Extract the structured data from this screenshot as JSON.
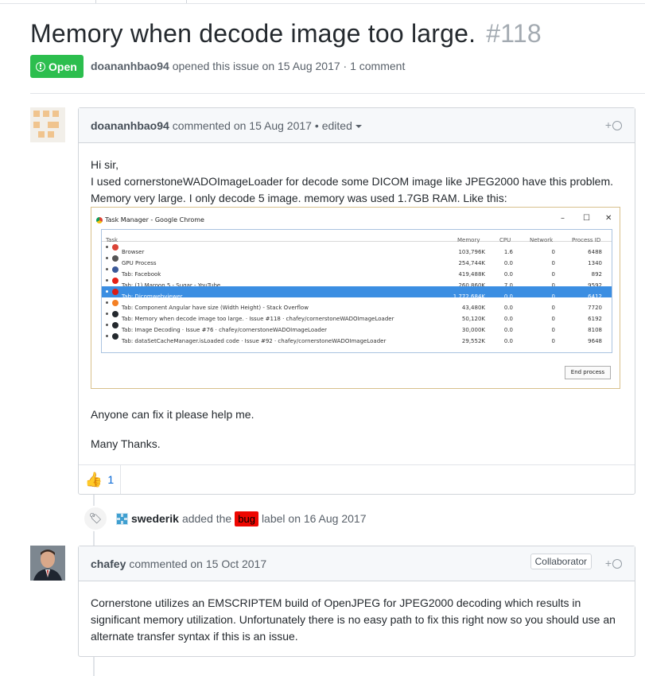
{
  "issue": {
    "title": "Memory when decode image too large.",
    "number": "#118",
    "state": "Open",
    "author": "doananhbao94",
    "meta_text": "opened this issue on 15 Aug 2017 · 1 comment"
  },
  "comment1": {
    "author": "doananhbao94",
    "meta": "commented on 15 Aug 2017 •",
    "edited": "edited",
    "react_plus": "+",
    "line1": "Hi sir,",
    "line2": "I used cornerstoneWADOImageLoader for decode some DICOM image like JPEG2000 have this problem.",
    "line3": "Memory very large. I only decode 5 image. memory was used 1.7GB RAM. Like this:",
    "line4": "Anyone can fix it please help me.",
    "line5": "Many Thanks.",
    "thumbs_count": "1"
  },
  "task_manager": {
    "title": "Task Manager - Google Chrome",
    "min": "–",
    "max": "☐",
    "close": "✕",
    "headers": [
      "Task",
      "Memory",
      "CPU",
      "Network",
      "Process ID"
    ],
    "rows": [
      {
        "task": "Browser",
        "memory": "103,796K",
        "cpu": "1.6",
        "network": "0",
        "pid": "6488",
        "color": "#db4437"
      },
      {
        "task": "GPU Process",
        "memory": "254,744K",
        "cpu": "0.0",
        "network": "0",
        "pid": "1340",
        "color": "#555555"
      },
      {
        "task": "Tab: Facebook",
        "memory": "419,488K",
        "cpu": "0.0",
        "network": "0",
        "pid": "892",
        "color": "#3b5998"
      },
      {
        "task": "Tab: (1) Maroon 5 - Sugar - YouTube",
        "memory": "260,860K",
        "cpu": "7.0",
        "network": "0",
        "pid": "9592",
        "color": "#e62117"
      },
      {
        "task": "Tab: Dicomwebviewer",
        "memory": "1,772,684K",
        "cpu": "0.0",
        "network": "0",
        "pid": "6412",
        "color": "#dd1b16"
      },
      {
        "task": "Tab: Component Angular have size (Width Height) - Stack Overflow",
        "memory": "43,480K",
        "cpu": "0.0",
        "network": "0",
        "pid": "7720",
        "color": "#f48024"
      },
      {
        "task": "Tab: Memory when decode image too large. · Issue #118 · chafey/cornerstoneWADOImageLoader",
        "memory": "50,120K",
        "cpu": "0.0",
        "network": "0",
        "pid": "6192",
        "color": "#24292e"
      },
      {
        "task": "Tab: Image Decoding · Issue #76 · chafey/cornerstoneWADOImageLoader",
        "memory": "30,000K",
        "cpu": "0.0",
        "network": "0",
        "pid": "8108",
        "color": "#24292e"
      },
      {
        "task": "Tab: dataSetCacheManager.isLoaded code · Issue #92 · chafey/cornerstoneWADOImageLoader",
        "memory": "29,552K",
        "cpu": "0.0",
        "network": "0",
        "pid": "9648",
        "color": "#24292e"
      }
    ],
    "selected_index": 4,
    "end_process": "End process"
  },
  "label_event": {
    "actor": "swederik",
    "before": "added the",
    "label": "bug",
    "after": "label on 16 Aug 2017"
  },
  "comment2": {
    "author": "chafey",
    "meta": "commented on 15 Oct 2017",
    "badge": "Collaborator",
    "react_plus": "+",
    "text": "Cornerstone utilizes an EMSCRIPTEM build of OpenJPEG for JPEG2000 decoding which results in significant memory utilization. Unfortunately there is no easy path to fix this right now so you should use an alternate transfer syntax if this is an issue."
  }
}
